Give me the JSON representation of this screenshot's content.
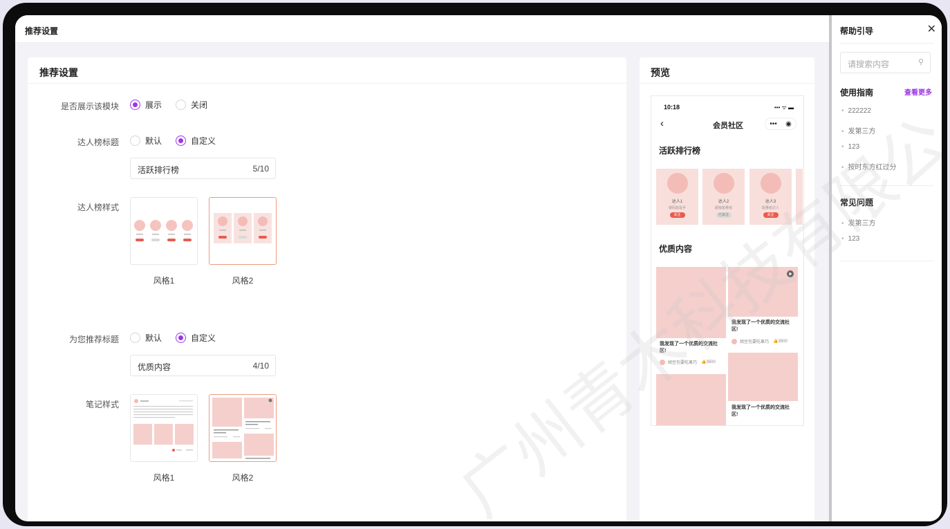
{
  "topbar": {
    "title": "推荐设置"
  },
  "settings": {
    "card_title": "推荐设置",
    "show_module": {
      "label": "是否展示该模块",
      "options": [
        "展示",
        "关闭"
      ],
      "selected": "展示"
    },
    "talent_title": {
      "label": "达人榜标题",
      "options": [
        "默认",
        "自定义"
      ],
      "selected": "自定义",
      "value": "活跃排行榜",
      "count": "5/10"
    },
    "talent_style": {
      "label": "达人榜样式",
      "options": [
        "风格1",
        "风格2"
      ],
      "selected": "风格2"
    },
    "recommend_title": {
      "label": "为您推荐标题",
      "options": [
        "默认",
        "自定义"
      ],
      "selected": "自定义",
      "value": "优质内容",
      "count": "4/10"
    },
    "note_style": {
      "label": "笔记样式",
      "options": [
        "风格1",
        "风格2"
      ],
      "selected": "风格2"
    }
  },
  "preview": {
    "card_title": "预览",
    "phone": {
      "time": "10:18",
      "signal": "••• ᯤ ▬",
      "back": "‹",
      "title": "会员社区",
      "caps_more": "•••",
      "caps_close": "◉",
      "ranking_title": "活跃排行榜",
      "talents": [
        {
          "name": "达人1",
          "desc": "做码能是手",
          "button": "关注",
          "button_style": "red"
        },
        {
          "name": "达人2",
          "desc": "超级能量级",
          "button": "已关注",
          "button_style": "gray"
        },
        {
          "name": "达人3",
          "desc": "能量级达人",
          "button": "关注",
          "button_style": "red"
        }
      ],
      "content_title": "优质内容",
      "notes": [
        {
          "text": "我发现了一个优质的交流社区!",
          "author": "胡豆包要吃果巧",
          "likes": "3500"
        },
        {
          "text": "我发现了一个优质的交流社区!",
          "author": "胡豆包要吃果巧",
          "likes": "3500"
        },
        {
          "text": "我发现了一个优质的交流社区!",
          "author": "",
          "likes": ""
        }
      ]
    }
  },
  "help": {
    "title": "帮助引导",
    "close": "✕",
    "search_placeholder": "请搜索内容",
    "guide_title": "使用指南",
    "guide_more": "查看更多",
    "guide_items": [
      "222222",
      "发第三方",
      "123",
      "按时东方红过分"
    ],
    "faq_title": "常见问题",
    "faq_items": [
      "发第三方",
      "123"
    ]
  },
  "watermark": "广州青木科技有限公"
}
